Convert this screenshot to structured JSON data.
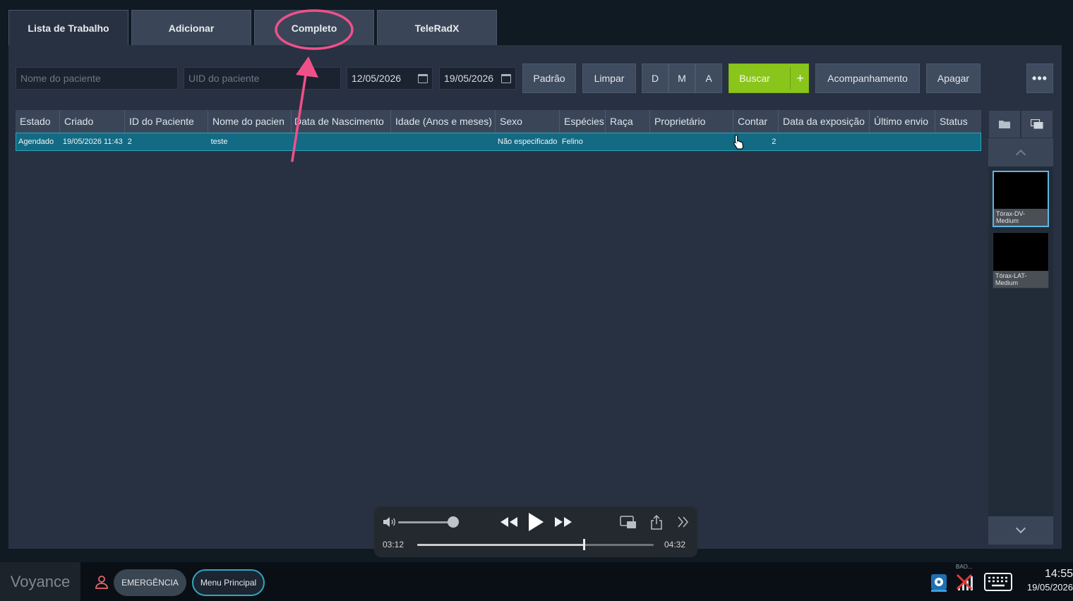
{
  "tabs": [
    {
      "label": "Lista de Trabalho",
      "active": true
    },
    {
      "label": "Adicionar",
      "active": false
    },
    {
      "label": "Completo",
      "active": false
    },
    {
      "label": "TeleRadX",
      "active": false
    }
  ],
  "toolbar": {
    "patient_name_placeholder": "Nome do paciente",
    "patient_uid_placeholder": "UID do paciente",
    "date_from": "12/05/2026",
    "date_to": "19/05/2026",
    "default_label": "Padrão",
    "clear_label": "Limpar",
    "day_label": "D",
    "month_label": "M",
    "year_label": "A",
    "search_label": "Buscar",
    "search_add_label": "+",
    "follow_up_label": "Acompanhamento",
    "delete_label": "Apagar",
    "more_label": "•••"
  },
  "table": {
    "columns": [
      "Estado",
      "Criado",
      "ID do Paciente",
      "Nome do pacien",
      "Data de Nascimento",
      "Idade (Anos e meses)",
      "Sexo",
      "Espécies",
      "Raça",
      "Proprietário",
      "Contar",
      "Data da exposição",
      "Último envio",
      "Status"
    ],
    "rows": [
      [
        "Agendado",
        "19/05/2026 11:43",
        "2",
        "teste",
        "",
        "",
        "Não especificado",
        "Felino",
        "",
        "",
        "2",
        "",
        "",
        ""
      ]
    ]
  },
  "thumbnails": [
    {
      "label": "Tórax-DV-Medium",
      "selected": true
    },
    {
      "label": "Tórax-LAT-Medium",
      "selected": false
    }
  ],
  "media": {
    "current_time": "03:12",
    "total_time": "04:32",
    "volume_level": 1.0,
    "progress": 0.705
  },
  "taskbar": {
    "brand": "Voyance",
    "emergency_label": "EMERGÊNCIA",
    "main_menu_label": "Menu Principal",
    "tray_label": "BAO...",
    "time": "14:55",
    "date": "19/05/2026"
  },
  "colors": {
    "accent_green": "#8ac51c",
    "selected_row": "#126a83",
    "annotation": "#f0508a"
  }
}
